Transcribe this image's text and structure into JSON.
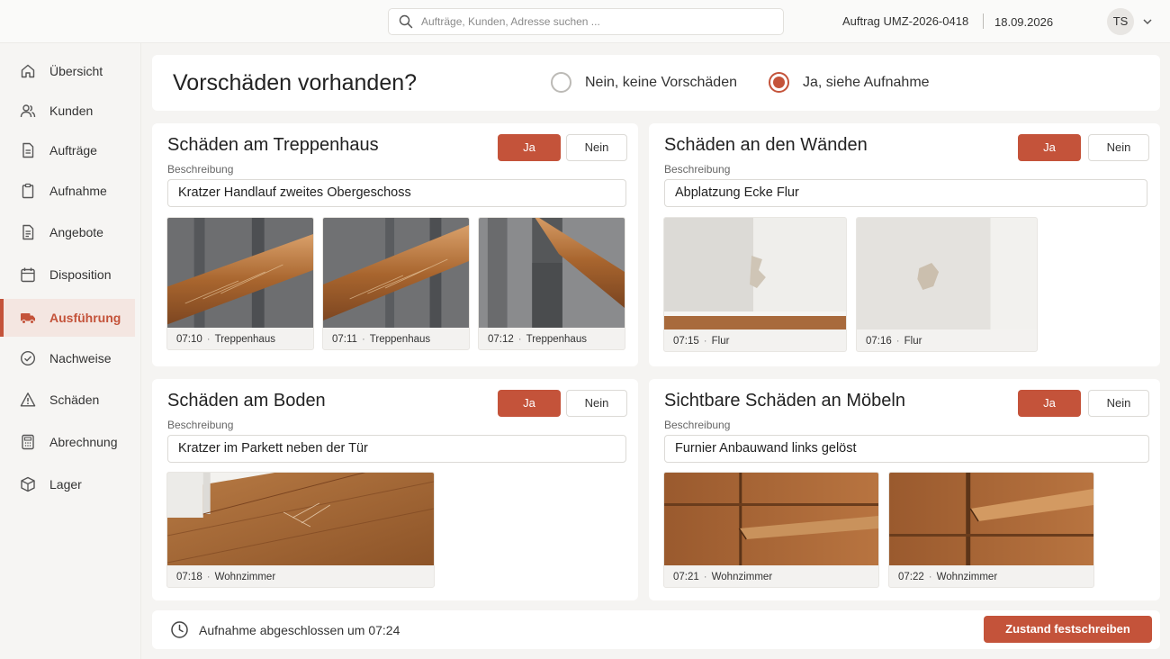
{
  "header": {
    "search_placeholder": "Aufträge, Kunden, Adresse suchen ...",
    "order_label": "Auftrag UMZ-2026-0418",
    "date": "18.09.2026",
    "avatar_initials": "TS"
  },
  "sidebar": {
    "items": [
      {
        "label": "Übersicht",
        "icon": "home-icon"
      },
      {
        "label": "Kunden",
        "icon": "users-icon"
      },
      {
        "label": "Aufträge",
        "icon": "document-icon"
      },
      {
        "label": "Aufnahme",
        "icon": "clipboard-icon"
      },
      {
        "label": "Angebote",
        "icon": "document-list-icon"
      },
      {
        "label": "Disposition",
        "icon": "calendar-icon"
      },
      {
        "label": "Ausführung",
        "icon": "truck-icon",
        "active": true
      },
      {
        "label": "Nachweise",
        "icon": "check-circle-icon"
      },
      {
        "label": "Schäden",
        "icon": "warning-icon"
      },
      {
        "label": "Abrechnung",
        "icon": "calculator-icon"
      },
      {
        "label": "Lager",
        "icon": "box-icon"
      }
    ]
  },
  "question": {
    "title": "Vorschäden vorhanden?",
    "option_no": "Nein, keine Vorschäden",
    "option_yes": "Ja, siehe Aufnahme",
    "selected": "yes"
  },
  "labels": {
    "ja": "Ja",
    "nein": "Nein",
    "beschreibung": "Beschreibung"
  },
  "sections": [
    {
      "title": "Schäden am Treppenhaus",
      "answer": "Ja",
      "description": "Kratzer Handlauf zweites Obergeschoss",
      "photos": [
        {
          "time": "07:10",
          "location": "Treppenhaus"
        },
        {
          "time": "07:11",
          "location": "Treppenhaus"
        },
        {
          "time": "07:12",
          "location": "Treppenhaus"
        }
      ]
    },
    {
      "title": "Schäden an den Wänden",
      "answer": "Ja",
      "description": "Abplatzung Ecke Flur",
      "photos": [
        {
          "time": "07:15",
          "location": "Flur"
        },
        {
          "time": "07:16",
          "location": "Flur"
        }
      ]
    },
    {
      "title": "Schäden am Boden",
      "answer": "Ja",
      "description": "Kratzer im Parkett neben der Tür",
      "photos": [
        {
          "time": "07:18",
          "location": "Wohnzimmer"
        }
      ]
    },
    {
      "title": "Sichtbare Schäden an Möbeln",
      "answer": "Ja",
      "description": "Furnier Anbauwand links gelöst",
      "photos": [
        {
          "time": "07:21",
          "location": "Wohnzimmer"
        },
        {
          "time": "07:22",
          "location": "Wohnzimmer"
        }
      ]
    }
  ],
  "footer": {
    "status": "Aufnahme abgeschlossen um 07:24",
    "button": "Zustand festschreiben"
  },
  "colors": {
    "accent": "#c4533a",
    "active_bg": "#f4e6e1"
  }
}
